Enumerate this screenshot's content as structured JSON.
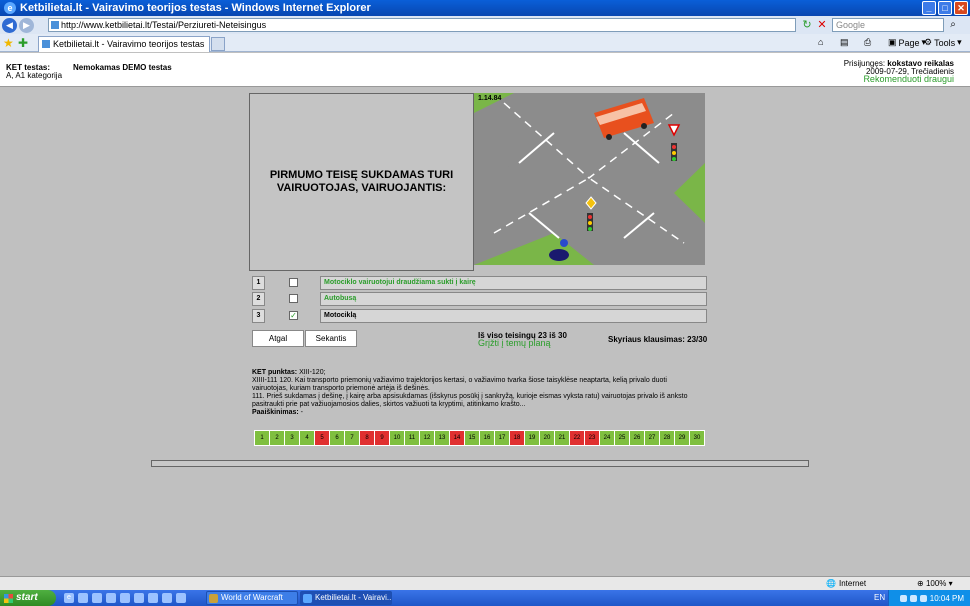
{
  "window": {
    "title": "Ketbilietai.lt - Vairavimo teorijos testas - Windows Internet Explorer"
  },
  "address": {
    "url": "http://www.ketbilietai.lt/Testai/Perziureti-Neteisingus",
    "search_placeholder": "Google"
  },
  "tab": {
    "label": "Ketbilietai.lt - Vairavimo teorijos testas"
  },
  "commands": {
    "page": "Page",
    "tools": "Tools"
  },
  "header": {
    "ket_label": "KET testas:",
    "category": "A, A1 kategorija",
    "demo_title": "Nemokamas DEMO testas",
    "login_prefix": "Prisijungęs:",
    "login_user": "kokstavo reikalas",
    "date": "2009-07-29, Trečiadienis",
    "recommend": "Rekomenduoti draugui"
  },
  "question": {
    "text": "PIRMUMO TEISĘ SUKDAMAS TURI VAIRUOTOJAS, VAIRUOJANTIS:",
    "code": "1.14.84",
    "answers": [
      {
        "num": "1",
        "text": "Motociklo vairuotojui draudžiama sukti į kairę",
        "checked": false
      },
      {
        "num": "2",
        "text": "Autobusą",
        "checked": false
      },
      {
        "num": "3",
        "text": "Motociklą",
        "checked": true
      }
    ]
  },
  "nav": {
    "back": "Atgal",
    "next": "Sekantis",
    "score": "Iš viso teisingų 23 iš 30",
    "back_to_topics": "Grįžti į temų planą",
    "section_score": "Skyriaus klausimas: 23/30"
  },
  "rule": {
    "label": "KET punktas:",
    "ref": "XIII-120;",
    "p1": "XIIII-111 120. Kai transporto priemonių važiavimo trajektorijos kertasi, o važiavimo tvarka šiose taisyklėse neaptarta, kelią privalo duoti vairuotojas, kuriam transporto priemonė artėja iš dešinės.",
    "p2": "111. Prieš sukdamas į dešinę, į kairę arba apsisukdamas (išskyrus posūkį į sankryžą, kurioje eismas vyksta ratu) vairuotojas privalo iš anksto pasitraukti prie pat važiuojamosios dalies, skirtos važiuoti ta kryptimi, atitinkamo krašto...",
    "expl_label": "Paaiškinimas:",
    "expl": "-"
  },
  "grid": {
    "numbers": [
      "1",
      "2",
      "3",
      "4",
      "5",
      "6",
      "7",
      "8",
      "9",
      "10",
      "11",
      "12",
      "13",
      "14",
      "15",
      "16",
      "17",
      "18",
      "19",
      "20",
      "21",
      "22",
      "23",
      "24",
      "25",
      "26",
      "27",
      "28",
      "29",
      "30"
    ],
    "wrong": [
      "5",
      "8",
      "9",
      "14",
      "18",
      "22",
      "23"
    ]
  },
  "status": {
    "zone": "Internet",
    "zoom": "100%"
  },
  "taskbar": {
    "start": "start",
    "task1": "World of Warcraft",
    "task2": "Ketbilietai.lt - Vairavi...",
    "lang": "EN",
    "time": "10:04 PM"
  },
  "colors": {
    "accent_green": "#2a9d2a",
    "wrong_red": "#e03030",
    "correct_green": "#7fbf3f",
    "ie_blue": "#0a5fd8"
  }
}
